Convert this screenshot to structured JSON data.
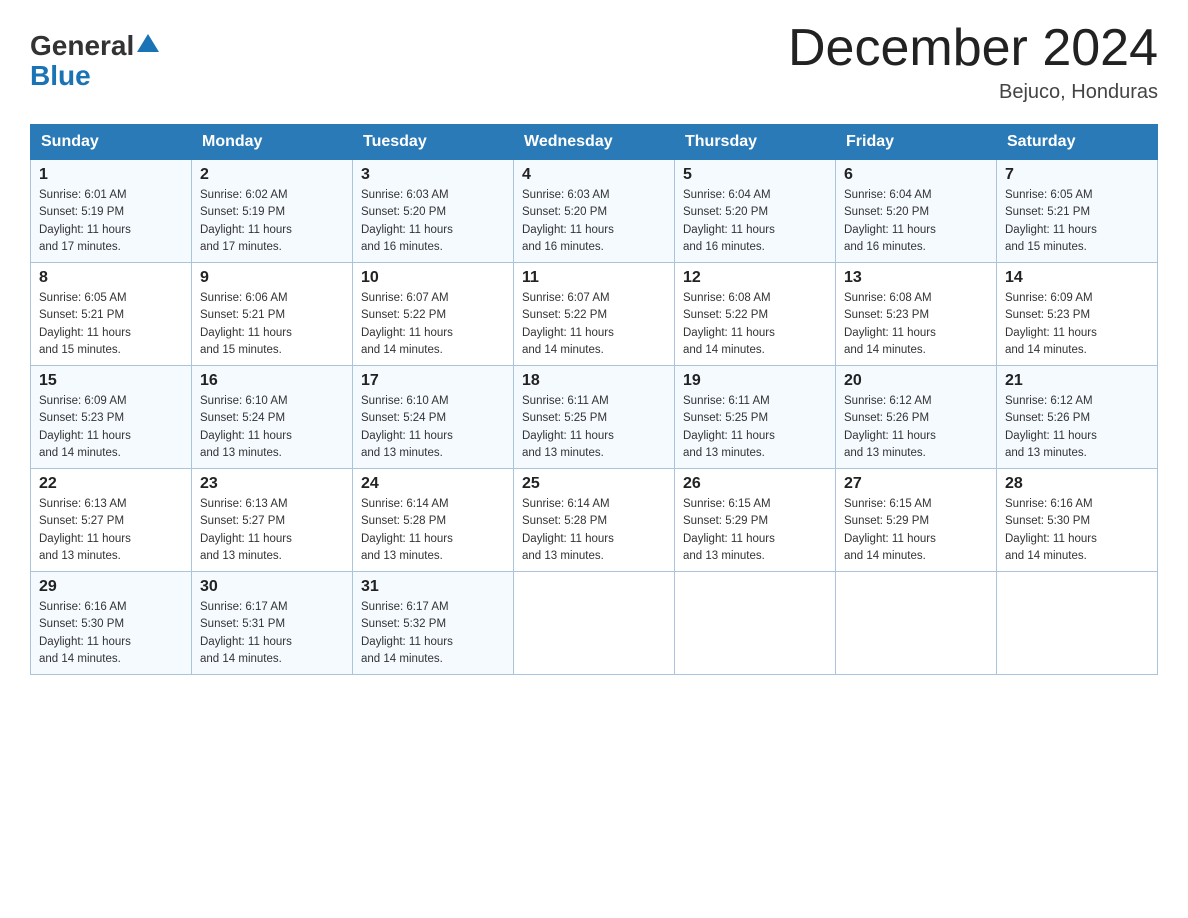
{
  "header": {
    "logo_general": "General",
    "logo_blue": "Blue",
    "month_title": "December 2024",
    "location": "Bejuco, Honduras"
  },
  "days_of_week": [
    "Sunday",
    "Monday",
    "Tuesday",
    "Wednesday",
    "Thursday",
    "Friday",
    "Saturday"
  ],
  "weeks": [
    [
      {
        "day": "1",
        "sunrise": "6:01 AM",
        "sunset": "5:19 PM",
        "daylight": "11 hours and 17 minutes."
      },
      {
        "day": "2",
        "sunrise": "6:02 AM",
        "sunset": "5:19 PM",
        "daylight": "11 hours and 17 minutes."
      },
      {
        "day": "3",
        "sunrise": "6:03 AM",
        "sunset": "5:20 PM",
        "daylight": "11 hours and 16 minutes."
      },
      {
        "day": "4",
        "sunrise": "6:03 AM",
        "sunset": "5:20 PM",
        "daylight": "11 hours and 16 minutes."
      },
      {
        "day": "5",
        "sunrise": "6:04 AM",
        "sunset": "5:20 PM",
        "daylight": "11 hours and 16 minutes."
      },
      {
        "day": "6",
        "sunrise": "6:04 AM",
        "sunset": "5:20 PM",
        "daylight": "11 hours and 16 minutes."
      },
      {
        "day": "7",
        "sunrise": "6:05 AM",
        "sunset": "5:21 PM",
        "daylight": "11 hours and 15 minutes."
      }
    ],
    [
      {
        "day": "8",
        "sunrise": "6:05 AM",
        "sunset": "5:21 PM",
        "daylight": "11 hours and 15 minutes."
      },
      {
        "day": "9",
        "sunrise": "6:06 AM",
        "sunset": "5:21 PM",
        "daylight": "11 hours and 15 minutes."
      },
      {
        "day": "10",
        "sunrise": "6:07 AM",
        "sunset": "5:22 PM",
        "daylight": "11 hours and 14 minutes."
      },
      {
        "day": "11",
        "sunrise": "6:07 AM",
        "sunset": "5:22 PM",
        "daylight": "11 hours and 14 minutes."
      },
      {
        "day": "12",
        "sunrise": "6:08 AM",
        "sunset": "5:22 PM",
        "daylight": "11 hours and 14 minutes."
      },
      {
        "day": "13",
        "sunrise": "6:08 AM",
        "sunset": "5:23 PM",
        "daylight": "11 hours and 14 minutes."
      },
      {
        "day": "14",
        "sunrise": "6:09 AM",
        "sunset": "5:23 PM",
        "daylight": "11 hours and 14 minutes."
      }
    ],
    [
      {
        "day": "15",
        "sunrise": "6:09 AM",
        "sunset": "5:23 PM",
        "daylight": "11 hours and 14 minutes."
      },
      {
        "day": "16",
        "sunrise": "6:10 AM",
        "sunset": "5:24 PM",
        "daylight": "11 hours and 13 minutes."
      },
      {
        "day": "17",
        "sunrise": "6:10 AM",
        "sunset": "5:24 PM",
        "daylight": "11 hours and 13 minutes."
      },
      {
        "day": "18",
        "sunrise": "6:11 AM",
        "sunset": "5:25 PM",
        "daylight": "11 hours and 13 minutes."
      },
      {
        "day": "19",
        "sunrise": "6:11 AM",
        "sunset": "5:25 PM",
        "daylight": "11 hours and 13 minutes."
      },
      {
        "day": "20",
        "sunrise": "6:12 AM",
        "sunset": "5:26 PM",
        "daylight": "11 hours and 13 minutes."
      },
      {
        "day": "21",
        "sunrise": "6:12 AM",
        "sunset": "5:26 PM",
        "daylight": "11 hours and 13 minutes."
      }
    ],
    [
      {
        "day": "22",
        "sunrise": "6:13 AM",
        "sunset": "5:27 PM",
        "daylight": "11 hours and 13 minutes."
      },
      {
        "day": "23",
        "sunrise": "6:13 AM",
        "sunset": "5:27 PM",
        "daylight": "11 hours and 13 minutes."
      },
      {
        "day": "24",
        "sunrise": "6:14 AM",
        "sunset": "5:28 PM",
        "daylight": "11 hours and 13 minutes."
      },
      {
        "day": "25",
        "sunrise": "6:14 AM",
        "sunset": "5:28 PM",
        "daylight": "11 hours and 13 minutes."
      },
      {
        "day": "26",
        "sunrise": "6:15 AM",
        "sunset": "5:29 PM",
        "daylight": "11 hours and 13 minutes."
      },
      {
        "day": "27",
        "sunrise": "6:15 AM",
        "sunset": "5:29 PM",
        "daylight": "11 hours and 14 minutes."
      },
      {
        "day": "28",
        "sunrise": "6:16 AM",
        "sunset": "5:30 PM",
        "daylight": "11 hours and 14 minutes."
      }
    ],
    [
      {
        "day": "29",
        "sunrise": "6:16 AM",
        "sunset": "5:30 PM",
        "daylight": "11 hours and 14 minutes."
      },
      {
        "day": "30",
        "sunrise": "6:17 AM",
        "sunset": "5:31 PM",
        "daylight": "11 hours and 14 minutes."
      },
      {
        "day": "31",
        "sunrise": "6:17 AM",
        "sunset": "5:32 PM",
        "daylight": "11 hours and 14 minutes."
      },
      null,
      null,
      null,
      null
    ]
  ]
}
